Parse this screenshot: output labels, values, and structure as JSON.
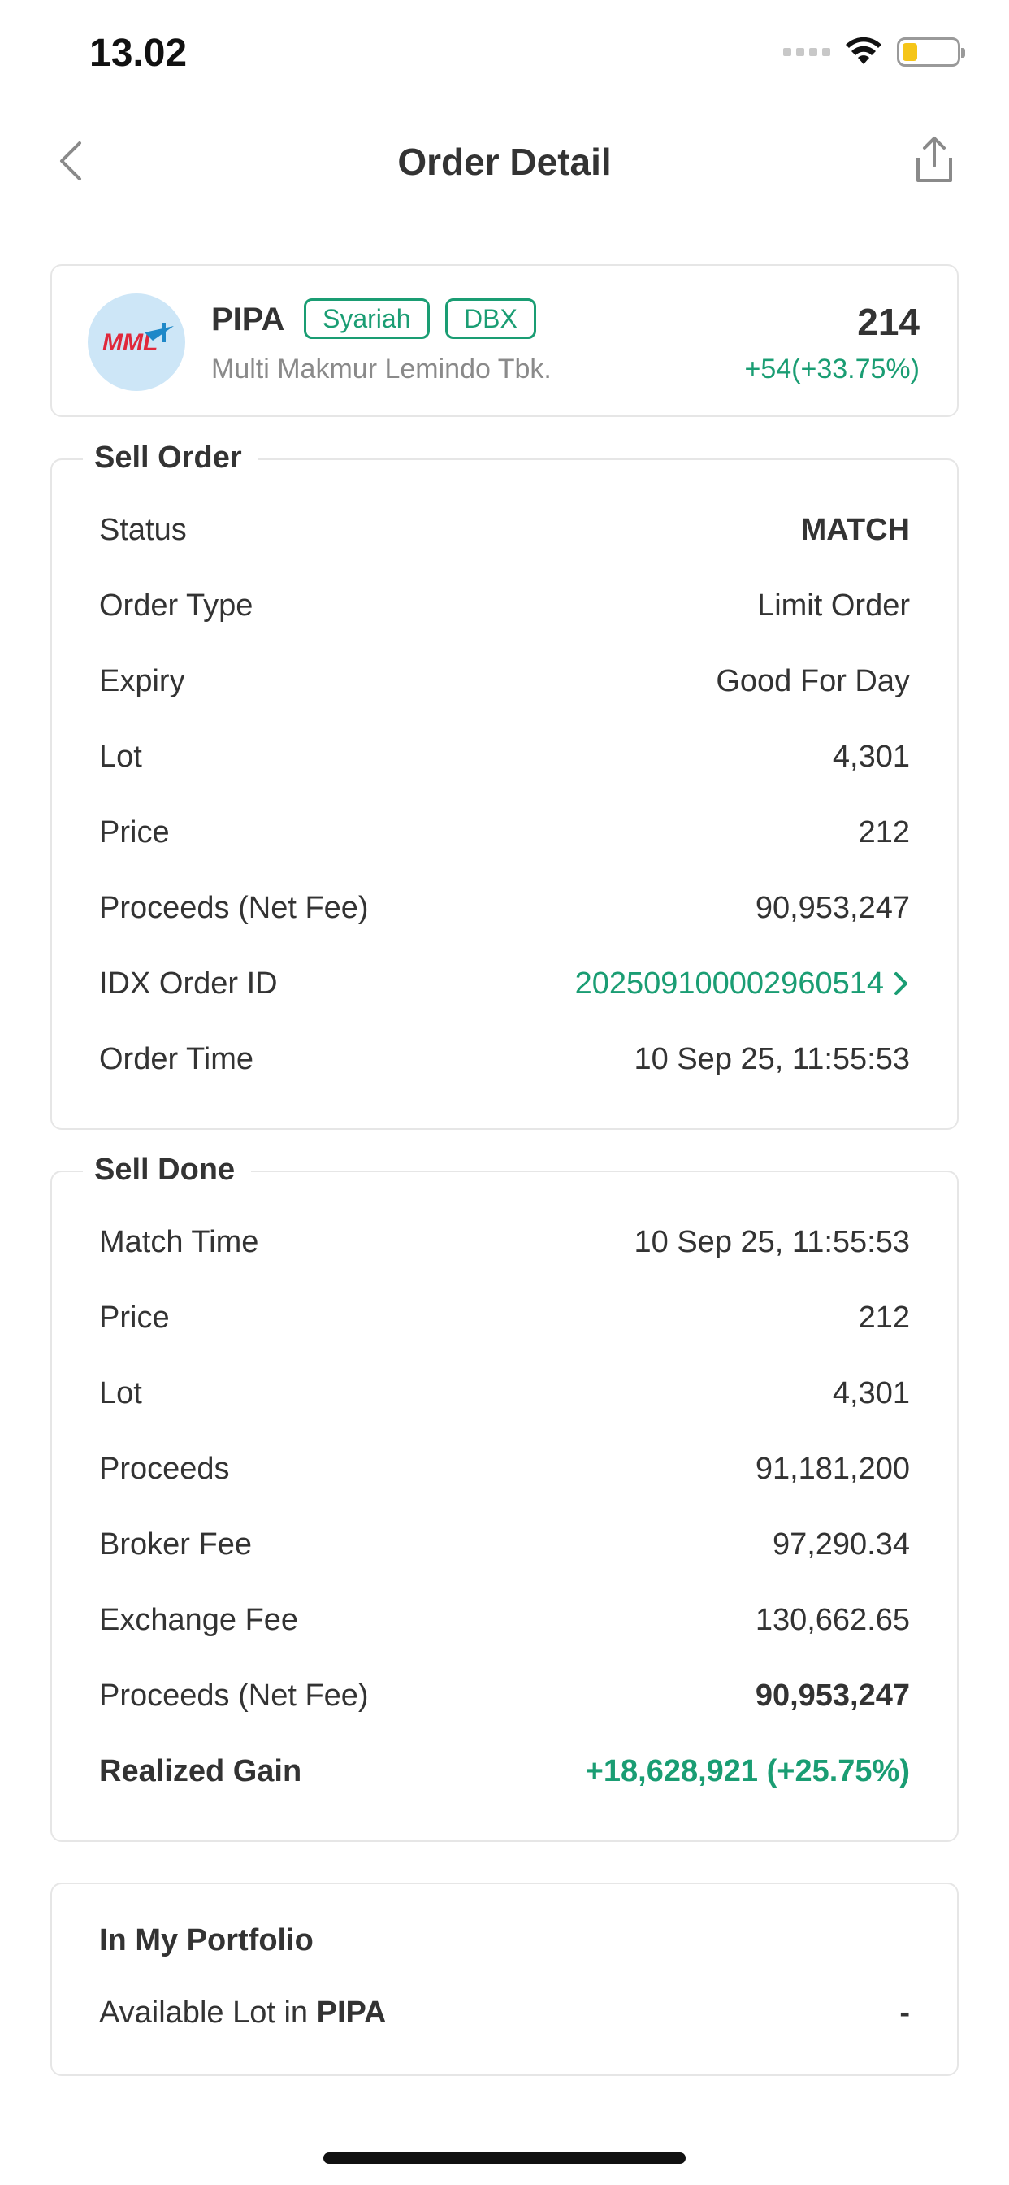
{
  "status_bar": {
    "time": "13.02"
  },
  "nav": {
    "title": "Order Detail"
  },
  "stock": {
    "code": "PIPA",
    "badges": [
      "Syariah",
      "DBX"
    ],
    "name": "Multi Makmur Lemindo Tbk.",
    "price": "214",
    "change": "+54(+33.75%)",
    "logo_text": "MML"
  },
  "sell_order": {
    "title": "Sell Order",
    "rows": [
      {
        "label": "Status",
        "value": "MATCH"
      },
      {
        "label": "Order Type",
        "value": "Limit Order"
      },
      {
        "label": "Expiry",
        "value": "Good For Day"
      },
      {
        "label": "Lot",
        "value": "4,301"
      },
      {
        "label": "Price",
        "value": "212"
      },
      {
        "label": "Proceeds (Net Fee)",
        "value": "90,953,247"
      },
      {
        "label": "IDX Order ID",
        "value": "20250910000296​0514"
      },
      {
        "label": "Order Time",
        "value": "10 Sep 25, 11:55:53"
      }
    ]
  },
  "sell_done": {
    "title": "Sell Done",
    "rows": [
      {
        "label": "Match Time",
        "value": "10 Sep 25, 11:55:53"
      },
      {
        "label": "Price",
        "value": "212"
      },
      {
        "label": "Lot",
        "value": "4,301"
      },
      {
        "label": "Proceeds",
        "value": "91,181,200"
      },
      {
        "label": "Broker Fee",
        "value": "97,290.34"
      },
      {
        "label": "Exchange Fee",
        "value": "130,662.65"
      },
      {
        "label": "Proceeds (Net Fee)",
        "value": "90,953,247"
      },
      {
        "label": "Realized Gain",
        "value": "+18,628,921 (+25.75%)"
      }
    ]
  },
  "portfolio": {
    "title": "In My Portfolio",
    "available_label": "Available Lot in ",
    "available_code": "PIPA",
    "available_value": "-"
  },
  "colors": {
    "accent_green": "#1a9d73",
    "text": "#333333",
    "border": "#e6e6e6"
  }
}
